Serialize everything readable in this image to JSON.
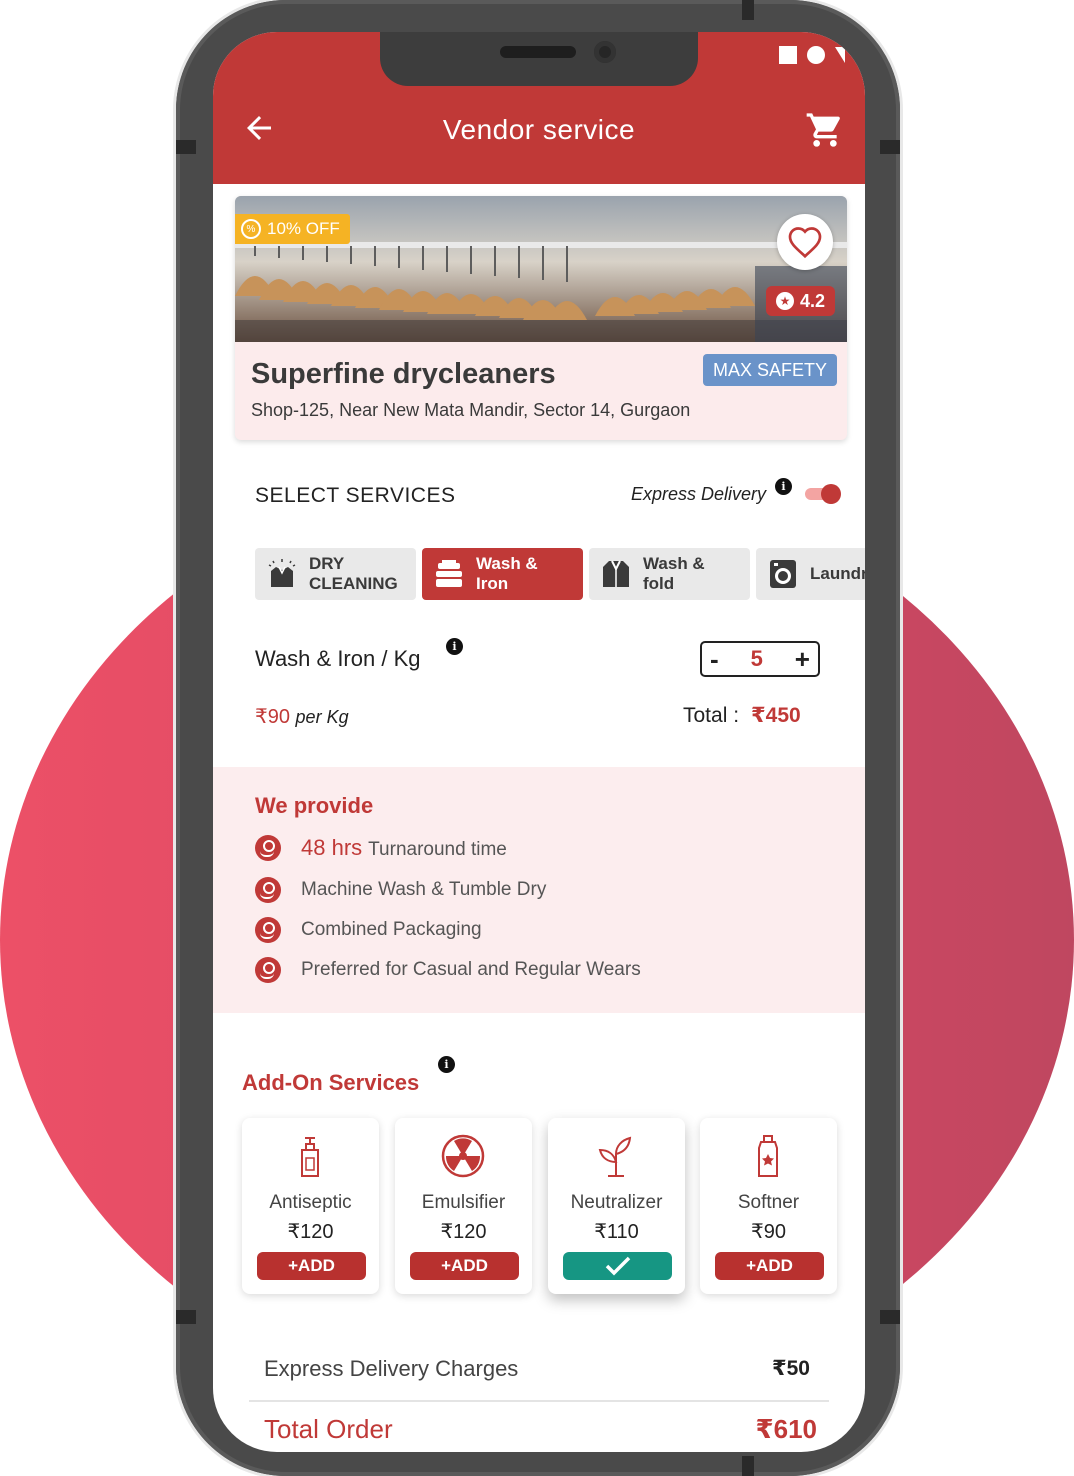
{
  "header": {
    "title": "Vendor service"
  },
  "vendor": {
    "offer": "10% OFF",
    "rating": "4.2",
    "name": "Superfine drycleaners",
    "badge": "MAX SAFETY",
    "address": "Shop-125, Near New Mata Mandir, Sector 14, Gurgaon"
  },
  "services": {
    "heading": "SELECT SERVICES",
    "express_label": "Express Delivery",
    "express_on": true,
    "tabs": [
      {
        "line1": "DRY",
        "line2": "CLEANING",
        "icon": "dry-cleaning-icon",
        "active": false
      },
      {
        "line1": "Wash &",
        "line2": "Iron",
        "icon": "wash-iron-icon",
        "active": true
      },
      {
        "line1": "Wash &",
        "line2": "fold",
        "icon": "wash-fold-icon",
        "active": false
      },
      {
        "line1": "Laundry",
        "line2": "",
        "icon": "washing-machine-icon",
        "active": false
      }
    ]
  },
  "item": {
    "name": "Wash & Iron / Kg",
    "quantity": "5",
    "minus": "-",
    "plus": "+",
    "price": "₹90",
    "unit": "per Kg",
    "total_label": "Total :",
    "total_value": "₹450"
  },
  "provide": {
    "heading": "We provide",
    "items": [
      {
        "bold": "48 hrs",
        "text": "Turnaround time"
      },
      {
        "bold": "",
        "text": "Machine Wash & Tumble Dry"
      },
      {
        "bold": "",
        "text": "Combined Packaging"
      },
      {
        "bold": "",
        "text": "Preferred for Casual and Regular Wears"
      }
    ]
  },
  "addons": {
    "heading": "Add-On Services",
    "items": [
      {
        "name": "Antiseptic",
        "price": "₹120",
        "button": "+ADD",
        "selected": false
      },
      {
        "name": "Emulsifier",
        "price": "₹120",
        "button": "+ADD",
        "selected": false
      },
      {
        "name": "Neutralizer",
        "price": "₹110",
        "button": "",
        "selected": true
      },
      {
        "name": "Softner",
        "price": "₹90",
        "button": "+ADD",
        "selected": false
      }
    ]
  },
  "summary": {
    "express_label": "Express Delivery Charges",
    "express_value": "₹50",
    "total_label": "Total Order",
    "total_value": "₹610"
  },
  "colors": {
    "primary": "#c03937",
    "accent_bg": "#fcedee",
    "success": "#169683",
    "badge": "#6a93c9",
    "offer": "#f5b324"
  }
}
